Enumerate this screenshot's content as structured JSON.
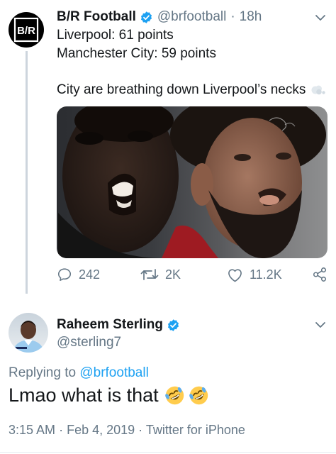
{
  "tweet": {
    "author": {
      "name": "B/R Football",
      "handle": "@brfootball",
      "logo_text": "B/R",
      "verified": true
    },
    "time": "18h",
    "separator": "·",
    "lines": [
      "Liverpool: 61 points",
      "Manchester City: 59 points",
      "City are breathing down Liverpool’s necks"
    ],
    "emoji": "dashing-away-emoji",
    "stats": {
      "replies": "242",
      "retweets": "2K",
      "likes": "11.2K"
    }
  },
  "reply": {
    "author": {
      "name": "Raheem Sterling",
      "handle": "@sterling7",
      "verified": true
    },
    "replying_prefix": "Replying to",
    "replying_to": "@brfootball",
    "text": "Lmao what is that",
    "emojis": [
      "rolling-on-the-floor-laughing",
      "rolling-on-the-floor-laughing"
    ],
    "timestamp": "3:15 AM",
    "date": "Feb 4, 2019",
    "client": "Twitter for iPhone",
    "sep": "·"
  },
  "colors": {
    "accent": "#1da1f2",
    "muted": "#657786",
    "text": "#14171a",
    "thread_line": "#cdd5dd"
  }
}
